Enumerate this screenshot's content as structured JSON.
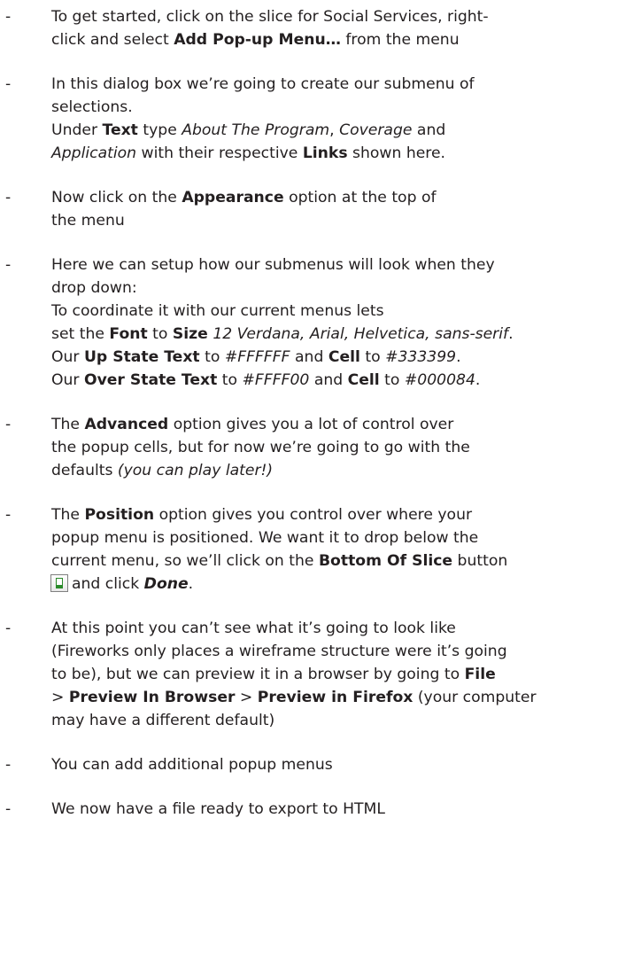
{
  "dash": "-",
  "items": [
    {
      "lines": [
        [
          "To get started, click on the slice for Social Services, right-"
        ],
        [
          "click and select ",
          {
            "b": "Add Pop-up Menu…"
          },
          " from the menu"
        ]
      ]
    },
    {
      "lines": [
        [
          "In this dialog box we’re going to create our submenu of"
        ],
        [
          "selections."
        ],
        [
          "Under ",
          {
            "b": "Text"
          },
          " type ",
          {
            "i": "About The Program"
          },
          ", ",
          {
            "i": "Coverage"
          },
          " and"
        ],
        [
          {
            "i": "Application"
          },
          " with their respective ",
          {
            "b": "Links"
          },
          " shown here."
        ]
      ]
    },
    {
      "lines": [
        [
          "Now click on the ",
          {
            "b": "Appearance"
          },
          " option at the top of"
        ],
        [
          "the menu"
        ]
      ]
    },
    {
      "lines": [
        [
          "Here we can setup how our submenus will look when they"
        ],
        [
          "drop down:"
        ],
        [
          "To coordinate it with our current menus lets"
        ],
        [
          "set the ",
          {
            "b": "Font"
          },
          " to ",
          {
            "b": "Size"
          },
          " ",
          {
            "i": "12  Verdana, Arial, Helvetica, sans-serif"
          },
          "."
        ],
        [
          "Our ",
          {
            "b": "Up State Text"
          },
          " to ",
          {
            "i": "#FFFFFF"
          },
          " and ",
          {
            "b": "Cell"
          },
          " to ",
          {
            "i": "#333399"
          },
          "."
        ],
        [
          "Our ",
          {
            "b": "Over State Text"
          },
          " to ",
          {
            "i": "#FFFF00"
          },
          " and ",
          {
            "b": "Cell"
          },
          " to ",
          {
            "i": "#000084"
          },
          "."
        ]
      ]
    },
    {
      "lines": [
        [
          "The ",
          {
            "b": "Advanced"
          },
          " option gives you a lot of control over"
        ],
        [
          "the popup cells, but for now we’re going to go with the"
        ],
        [
          "defaults ",
          {
            "i": "(you can play later!)"
          }
        ]
      ]
    },
    {
      "lines": [
        [
          "The ",
          {
            "b": "Position"
          },
          " option gives you control over where your"
        ],
        [
          "popup menu is positioned. We want it to drop below the"
        ],
        [
          "current menu, so we’ll click on the ",
          {
            "b": "Bottom Of Slice"
          },
          " button"
        ],
        [
          {
            "icon": "bottom-of-slice-icon"
          },
          "and click ",
          {
            "bi": "Done"
          },
          "."
        ]
      ]
    },
    {
      "lines": [
        [
          "At this point you can’t see what it’s going to look like"
        ],
        [
          "(Fireworks only places a wireframe structure were it’s going"
        ],
        [
          "to be), but we can preview it in a browser by going to ",
          {
            "b": "File"
          }
        ],
        [
          "> ",
          {
            "b": "Preview In Browser"
          },
          " > ",
          {
            "b": "Preview in Firefox"
          },
          " (your computer"
        ],
        [
          "may have a different default)"
        ]
      ]
    },
    {
      "lines": [
        [
          "You can add additional popup menus"
        ]
      ]
    },
    {
      "lines": [
        [
          "We now have a file ready to export to HTML"
        ]
      ]
    }
  ]
}
